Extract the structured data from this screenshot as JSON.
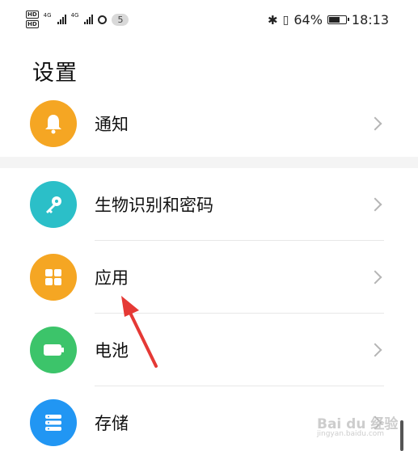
{
  "status_bar": {
    "hd_labels": [
      "HD",
      "HD"
    ],
    "network_labels": [
      "4G",
      "4G"
    ],
    "notification_count": "5",
    "battery_percent": "64%",
    "time": "18:13"
  },
  "page": {
    "title": "设置"
  },
  "settings_items": [
    {
      "label": "通知",
      "icon": "bell-icon",
      "color": "#f5a623"
    },
    {
      "label": "生物识别和密码",
      "icon": "key-icon",
      "color": "#2bbfc8"
    },
    {
      "label": "应用",
      "icon": "apps-grid-icon",
      "color": "#f5a623"
    },
    {
      "label": "电池",
      "icon": "battery-icon",
      "color": "#3cc46a"
    },
    {
      "label": "存储",
      "icon": "storage-icon",
      "color": "#2196f3"
    }
  ],
  "watermark": {
    "text": "Bai du 经验",
    "sub": "jingyan.baidu.com"
  },
  "colors": {
    "annotation_arrow": "#e53935"
  }
}
